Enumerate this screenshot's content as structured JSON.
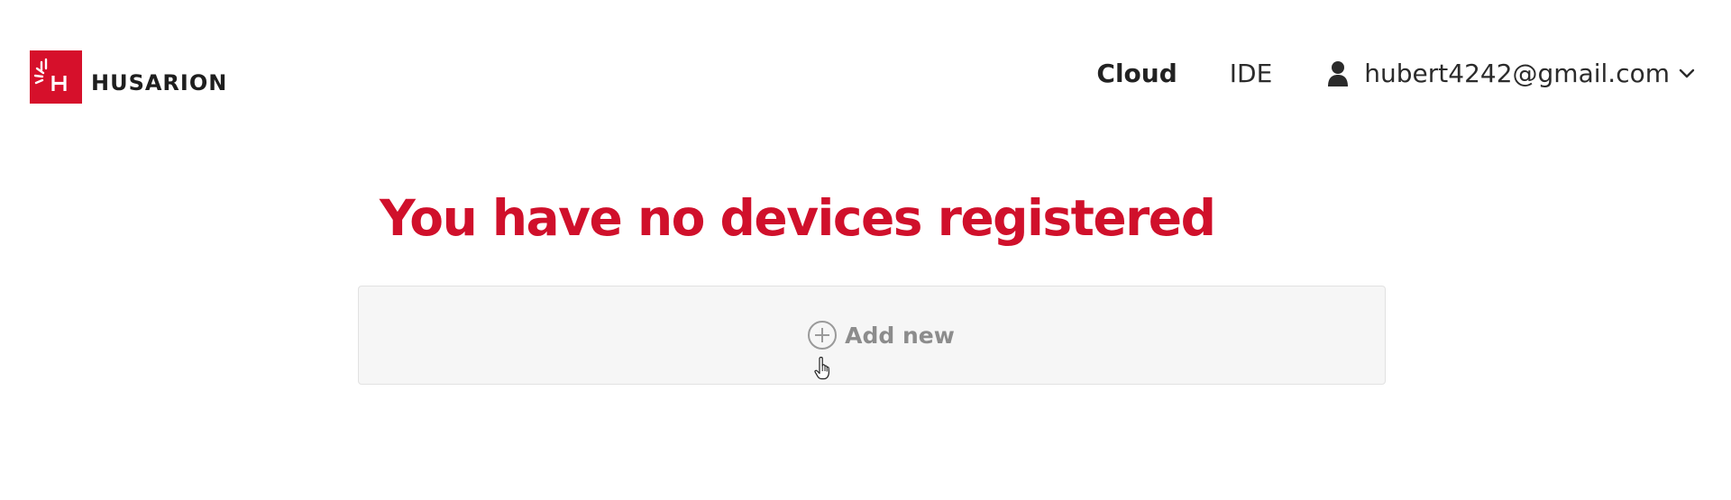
{
  "brand": {
    "name": "HUSARION",
    "logo_color": "#d6102b"
  },
  "nav": {
    "cloud_label": "Cloud",
    "ide_label": "IDE",
    "active": "Cloud"
  },
  "user": {
    "email": "hubert4242@gmail.com",
    "icon": "user-icon",
    "dropdown_icon": "chevron-down-icon"
  },
  "main": {
    "title": "You have no devices registered",
    "title_color": "#d0102b",
    "add_label": "Add new",
    "add_icon": "plus-circle-icon"
  }
}
